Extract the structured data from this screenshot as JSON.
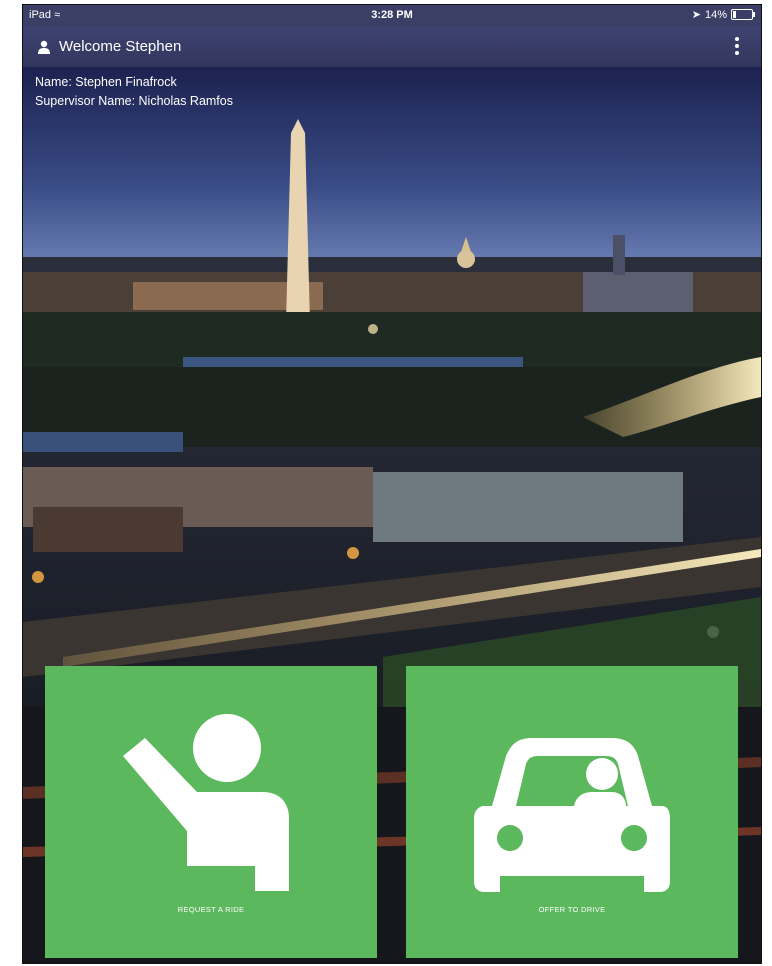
{
  "status_bar": {
    "carrier": "iPad",
    "time": "3:28 PM",
    "battery": "14%",
    "battery_level": 0.14
  },
  "header": {
    "title": "Welcome Stephen",
    "user_icon": "user-icon",
    "menu_icon": "vertical-dots-icon"
  },
  "profile": {
    "name_line": "Name: Stephen Finafrock",
    "supervisor_line": "Supervisor Name: Nicholas Ramfos"
  },
  "actions": {
    "request_ride": {
      "label": "REQUEST A RIDE",
      "icon": "raised-hand-person-icon"
    },
    "offer_drive": {
      "label": "OFFER TO DRIVE",
      "icon": "car-driver-icon"
    }
  },
  "colors": {
    "tile": "#5cb85c",
    "navbar": "#3b3f66"
  }
}
